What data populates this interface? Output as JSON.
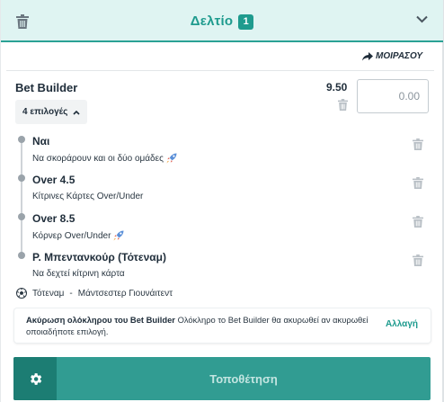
{
  "header": {
    "title": "Δελτίο",
    "count": "1",
    "icons": {
      "delete": "trash-icon",
      "collapse": "chevron-down-icon"
    }
  },
  "share": {
    "label": "ΜΟΙΡΑΣΟΥ",
    "icon": "share-arrow-icon"
  },
  "bet_builder": {
    "title": "Bet Builder",
    "selections_label": "4 επιλογές",
    "odds": "9.50",
    "stake_placeholder": "0.00"
  },
  "selections": [
    {
      "pick": "Ναι",
      "market": "Να σκοράρουν και οι δύο ομάδες",
      "rocket": true
    },
    {
      "pick": "Over 4.5",
      "market": "Κίτρινες Κάρτες Over/Under",
      "rocket": false
    },
    {
      "pick": "Over 8.5",
      "market": "Κόρνερ Over/Under",
      "rocket": true
    },
    {
      "pick": "Ρ. Μπεντανκούρ (Τότεναμ)",
      "market": "Να δεχτεί κίτρινη κάρτα",
      "rocket": false
    }
  ],
  "match": {
    "home": "Τότεναμ",
    "separator": "-",
    "away": "Μάντσεστερ Γιουνάιτεντ",
    "icon": "soccer-ball-icon"
  },
  "warning": {
    "bold": "Ακύρωση ολόκληρου του Bet Builder",
    "text": "Ολόκληρο το Bet Builder θα ακυρωθεί αν ακυρωθεί οποιαδήποτε επιλογή.",
    "action": "Αλλαγή"
  },
  "place_bet": {
    "label": "Τοποθέτηση",
    "settings_icon": "gear-icon"
  },
  "colors": {
    "accent": "#1e9b8e",
    "header_bg": "#dff4f2",
    "button": "#319c92",
    "button_dark": "#1c7d73"
  }
}
